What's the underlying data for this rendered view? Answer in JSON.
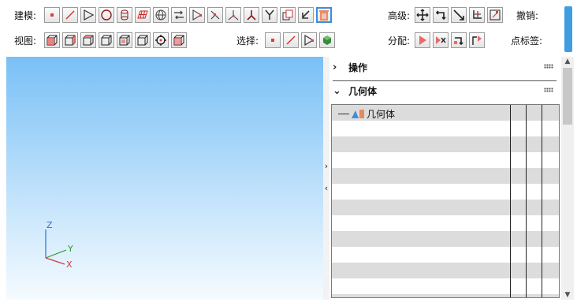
{
  "toolbar": {
    "modeling_label": "建模:",
    "view_label": "视图:",
    "advanced_label": "高级:",
    "undo_label": "撤销:",
    "select_label": "选择:",
    "assign_label": "分配:",
    "point_label_label": "点标签:"
  },
  "panel": {
    "operations_title": "操作",
    "geometry_title": "几何体",
    "tree_root_label": "几何体"
  },
  "axes": {
    "z": "Z",
    "y": "Y",
    "x": "X"
  },
  "colors": {
    "accent": "#3f9de0",
    "point": "#e03c3c",
    "sky_top": "#79c0f6"
  }
}
